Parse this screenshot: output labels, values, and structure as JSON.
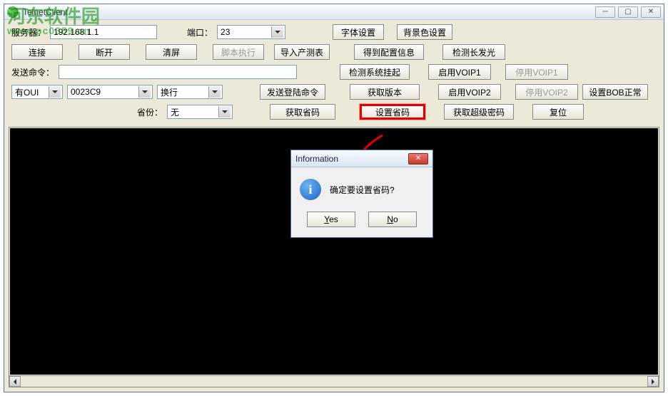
{
  "watermark": {
    "text": "河东软件园",
    "url": "www.pc0359.cn"
  },
  "window": {
    "title": "TelnetClient",
    "controls": {
      "min": "─",
      "max": "▢",
      "close": "✕"
    }
  },
  "row1": {
    "server_label": "服务器：",
    "server_value": "192.168.1.1",
    "port_label": "端口：",
    "port_value": "23",
    "font_btn": "字体设置",
    "bg_btn": "背景色设置"
  },
  "row2": {
    "connect": "连接",
    "disconnect": "断开",
    "clear": "清屏",
    "script": "脚本执行",
    "import": "导入产测表",
    "config": "得到配置信息",
    "detect": "检测长发光"
  },
  "row3": {
    "send_label": "发送命令：",
    "send_value": "",
    "detect_crash": "检测系统挂起",
    "enable1": "启用VOIP1",
    "disable1": "停用VOIP1"
  },
  "row4": {
    "oui_mode": "有OUI",
    "oui_value": "0023C9",
    "newline": "换行",
    "login_cmd": "发送登陆命令",
    "version": "获取版本",
    "enable2": "启用VOIP2",
    "disable2": "停用VOIP2",
    "bob": "设置BOB正常"
  },
  "row5": {
    "prov_label": "省份：",
    "prov_value": "无",
    "get_prov": "获取省码",
    "set_prov": "设置省码",
    "superpwd": "获取超级密码",
    "reset": "复位"
  },
  "dialog": {
    "title": "Information",
    "message": "确定要设置省码?",
    "yes": "Yes",
    "no": "No"
  }
}
